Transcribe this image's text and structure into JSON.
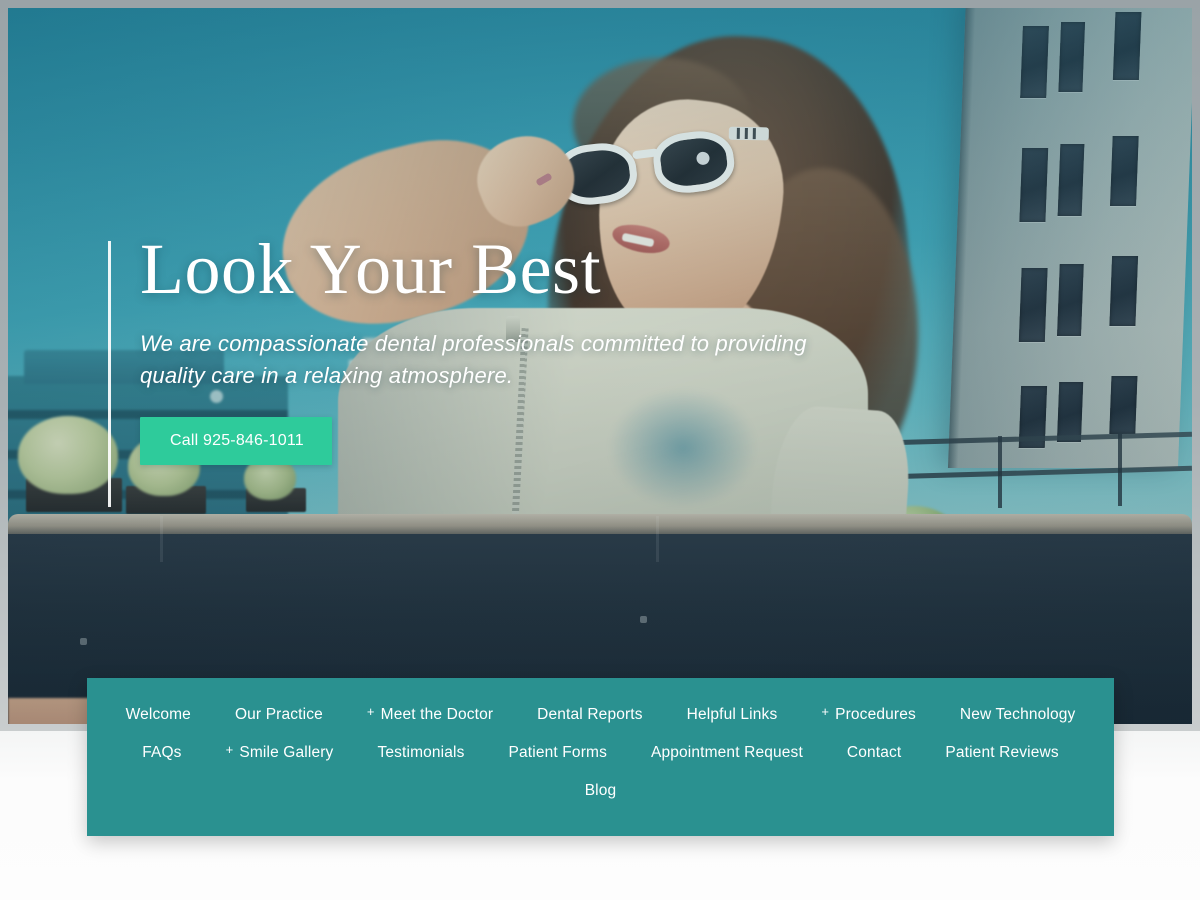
{
  "hero": {
    "title": "Look Your Best",
    "subtitle": "We are compassionate dental professionals committed to providing quality care in a relaxing atmosphere.",
    "cta_label": "Call 925-846-1011",
    "accent_color": "#2ecb9b",
    "image_alt": "woman-with-sunglasses-rooftop"
  },
  "nav": {
    "background_color": "#2a9190",
    "plus_symbol": "+",
    "row1": [
      {
        "label": "Welcome",
        "has_submenu": false
      },
      {
        "label": "Our Practice",
        "has_submenu": false
      },
      {
        "label": "Meet the Doctor",
        "has_submenu": true
      },
      {
        "label": "Dental Reports",
        "has_submenu": false
      },
      {
        "label": "Helpful Links",
        "has_submenu": false
      },
      {
        "label": "Procedures",
        "has_submenu": true
      },
      {
        "label": "New Technology",
        "has_submenu": false
      }
    ],
    "row2": [
      {
        "label": "FAQs",
        "has_submenu": false
      },
      {
        "label": "Smile Gallery",
        "has_submenu": true
      },
      {
        "label": "Testimonials",
        "has_submenu": false
      },
      {
        "label": "Patient Forms",
        "has_submenu": false
      },
      {
        "label": "Appointment Request",
        "has_submenu": false
      },
      {
        "label": "Contact",
        "has_submenu": false
      },
      {
        "label": "Patient Reviews",
        "has_submenu": false
      }
    ],
    "row3": [
      {
        "label": "Blog",
        "has_submenu": false
      }
    ]
  }
}
